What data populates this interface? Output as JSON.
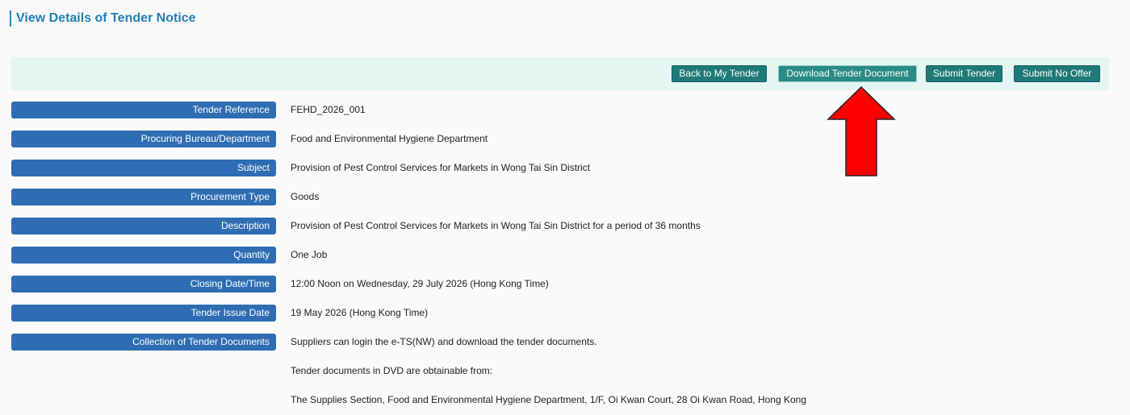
{
  "page": {
    "title": "View Details of Tender Notice"
  },
  "toolbar": {
    "back_label": "Back to My Tender",
    "download_label": "Download Tender Document",
    "submit_label": "Submit Tender",
    "no_offer_label": "Submit No Offer"
  },
  "fields": [
    {
      "label": "Tender Reference",
      "value": "FEHD_2026_001"
    },
    {
      "label": "Procuring Bureau/Department",
      "value": "Food and Environmental Hygiene Department"
    },
    {
      "label": "Subject",
      "value": "Provision of Pest Control Services for Markets in Wong Tai Sin District"
    },
    {
      "label": "Procurement Type",
      "value": "Goods"
    },
    {
      "label": "Description",
      "value": "Provision of Pest Control Services for Markets in Wong Tai Sin District for a period of 36 months"
    },
    {
      "label": "Quantity",
      "value": "One Job"
    },
    {
      "label": "Closing Date/Time",
      "value": "12:00 Noon on Wednesday, 29 July 2026 (Hong Kong Time)"
    },
    {
      "label": "Tender Issue Date",
      "value": "19 May 2026 (Hong Kong Time)"
    },
    {
      "label": "Collection of Tender Documents",
      "value": "Suppliers can login the e-TS(NW) and download the tender documents."
    }
  ],
  "collection_extra": [
    "Tender documents in DVD are obtainable from:",
    "The Supplies Section, Food and Environmental Hygiene Department, 1/F, Oi Kwan Court, 28 Oi Kwan Road, Hong Kong"
  ],
  "colors": {
    "title": "#1e7fb8",
    "toolbar_bg": "#e4f6f1",
    "button": "#1e7a78",
    "label_bg": "#2e6db3",
    "arrow": "#ff0000"
  },
  "icons": {
    "annotation": "red-up-arrow-icon"
  }
}
